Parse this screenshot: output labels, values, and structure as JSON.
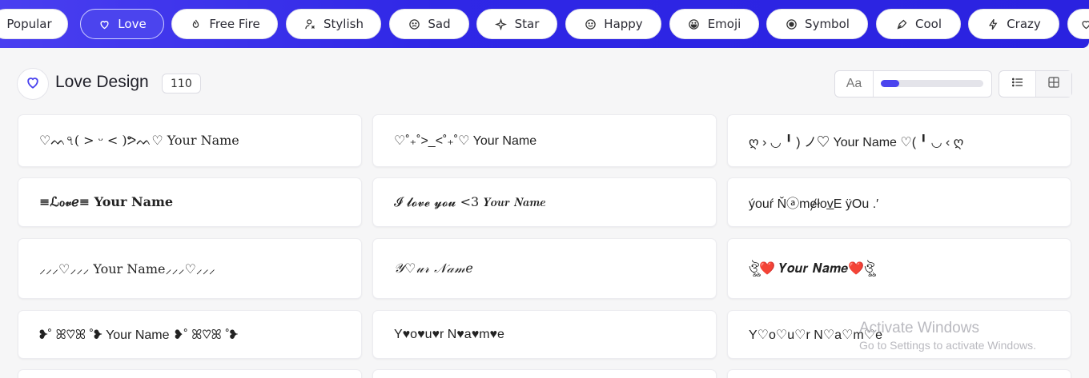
{
  "categories": [
    {
      "label": "Popular",
      "icon": "none",
      "active": false
    },
    {
      "label": "Love",
      "icon": "heart-icon",
      "active": true
    },
    {
      "label": "Free Fire",
      "icon": "flame-icon",
      "active": false
    },
    {
      "label": "Stylish",
      "icon": "person-icon",
      "active": false
    },
    {
      "label": "Sad",
      "icon": "sad-face-icon",
      "active": false
    },
    {
      "label": "Star",
      "icon": "sparkle-icon",
      "active": false
    },
    {
      "label": "Happy",
      "icon": "smile-icon",
      "active": false
    },
    {
      "label": "Emoji",
      "icon": "emoji-icon",
      "active": false
    },
    {
      "label": "Symbol",
      "icon": "symbol-icon",
      "active": false
    },
    {
      "label": "Cool",
      "icon": "pen-icon",
      "active": false
    },
    {
      "label": "Crazy",
      "icon": "lightning-icon",
      "active": false
    }
  ],
  "header": {
    "title": "Love Design",
    "count": "110",
    "icon": "heart-icon"
  },
  "controls": {
    "font_label": "Aa",
    "font_size_level": 0.18,
    "list_view_icon": "list-icon",
    "grid_view_icon": "grid-icon"
  },
  "cards": [
    "♡ᨓ৭( > ᵕ < )ᕗᨓ♡ Your Name",
    "♡˚₊˚>_<˚₊˚♡ Your Name",
    "ღ › ◡ ╹ ) ノ♡ Your Name ♡( ╹ ◡ ‹ ღ",
    "≡ℒℴ𝓋ℯ≡ Your Name",
    "𝓘 𝓵𝓸𝓿𝓮 𝔂𝓸𝓾 <3 𝒀𝒐𝒖𝒓 𝑵𝒂𝒎𝒆",
    "ýouŕ Ňⓐmɇłov̲E ÿOu .′",
    "⸝⸝⸝♡⸝⸝⸝ Your Name⸝⸝⸝♡⸝⸝⸝",
    "𝒴♡𝓊𝓇 𝒩𝒶𝓂𝑒",
    "ঔৣ❤️ 𝒀𝒐𝒖𝒓 𝑵𝒂𝒎𝒆❤️ঔৣ",
    "❥˚ ꕤ♡ꕤ ˚❥ Your Name ❥˚ ꕤ♡ꕤ ˚❥",
    "Y♥o♥u♥r N♥a♥m♥e",
    "Y♡o♡u♡r N♡a♡m♡e"
  ],
  "watermark": {
    "line1": "Activate Windows",
    "line2": "Go to Settings to activate Windows."
  },
  "colors": {
    "accent": "#4b44ee",
    "topbar": "#2f27e6",
    "background": "#f6f6f7"
  }
}
